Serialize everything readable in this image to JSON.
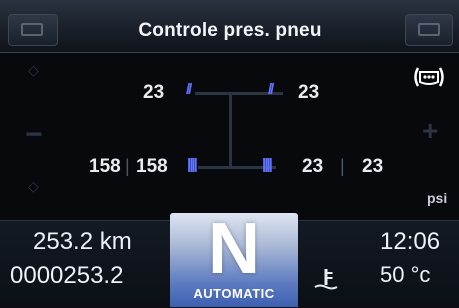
{
  "header": {
    "title": "Controle pres. pneu"
  },
  "tires": {
    "front_left": "23",
    "front_right": "23",
    "rear_outer_left": "158",
    "rear_inner_left": "158",
    "rear_inner_right": "23",
    "rear_outer_right": "23",
    "unit": "psi"
  },
  "status": {
    "trip_distance": "253.2 km",
    "total_distance": "0000253.2",
    "gear": "N",
    "transmission_mode": "AUTOMATIC",
    "time": "12:06",
    "temperature": "50 °c"
  },
  "icons": {
    "warning": "tire-pressure-warning-icon",
    "temperature": "temperature-icon"
  },
  "colors": {
    "accent_blue": "#5f73ff",
    "gear_panel": "#5c7bc0"
  }
}
